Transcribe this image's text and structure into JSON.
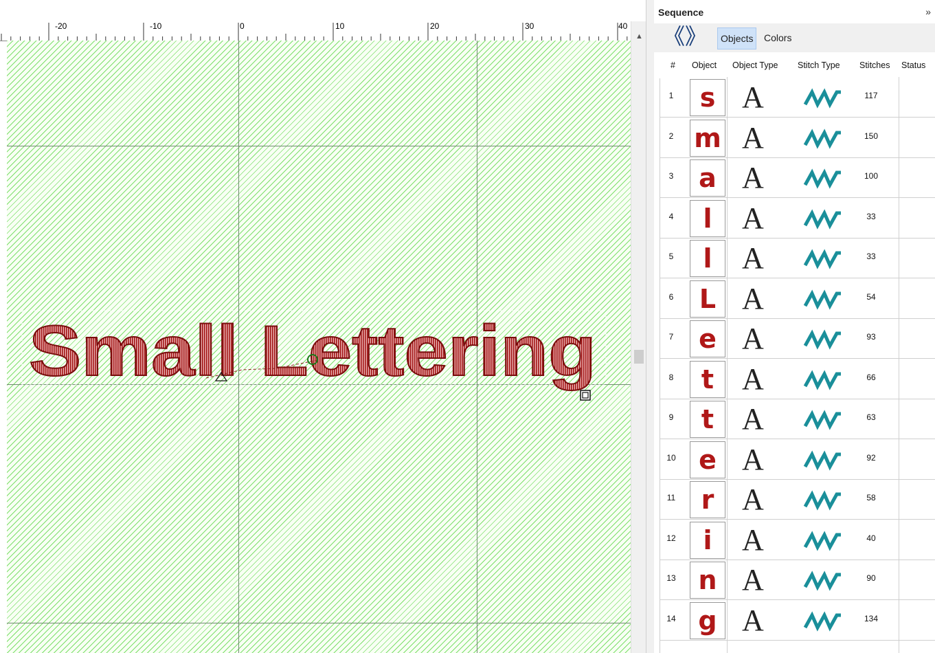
{
  "canvas": {
    "ruler_labels": [
      "-20",
      "-10",
      "0",
      "10",
      "20",
      "30",
      "40"
    ],
    "lettering_text": "Small Lettering"
  },
  "panel": {
    "title": "Sequence",
    "expand_label": "»",
    "nav_back": "《",
    "nav_forward": "》",
    "tabs": [
      {
        "label": "Objects",
        "active": true
      },
      {
        "label": "Colors",
        "active": false
      }
    ],
    "columns": [
      "#",
      "Object",
      "Object Type",
      "Stitch Type",
      "Stitches",
      "Status"
    ],
    "rows": [
      {
        "num": "1",
        "glyph": "s",
        "type_glyph": "A",
        "stitches": "117"
      },
      {
        "num": "2",
        "glyph": "m",
        "type_glyph": "A",
        "stitches": "150"
      },
      {
        "num": "3",
        "glyph": "a",
        "type_glyph": "A",
        "stitches": "100"
      },
      {
        "num": "4",
        "glyph": "l",
        "type_glyph": "A",
        "stitches": "33"
      },
      {
        "num": "5",
        "glyph": "l",
        "type_glyph": "A",
        "stitches": "33"
      },
      {
        "num": "6",
        "glyph": "L",
        "type_glyph": "A",
        "stitches": "54"
      },
      {
        "num": "7",
        "glyph": "e",
        "type_glyph": "A",
        "stitches": "93"
      },
      {
        "num": "8",
        "glyph": "t",
        "type_glyph": "A",
        "stitches": "66"
      },
      {
        "num": "9",
        "glyph": "t",
        "type_glyph": "A",
        "stitches": "63"
      },
      {
        "num": "10",
        "glyph": "e",
        "type_glyph": "A",
        "stitches": "92"
      },
      {
        "num": "11",
        "glyph": "r",
        "type_glyph": "A",
        "stitches": "58"
      },
      {
        "num": "12",
        "glyph": "i",
        "type_glyph": "A",
        "stitches": "40"
      },
      {
        "num": "13",
        "glyph": "n",
        "type_glyph": "A",
        "stitches": "90"
      },
      {
        "num": "14",
        "glyph": "g",
        "type_glyph": "A",
        "stitches": "134"
      }
    ]
  },
  "colors": {
    "thread": "#b01818",
    "stitch_icon": "#1a8f9a",
    "fabric_hatch": "#7ddf6b"
  }
}
